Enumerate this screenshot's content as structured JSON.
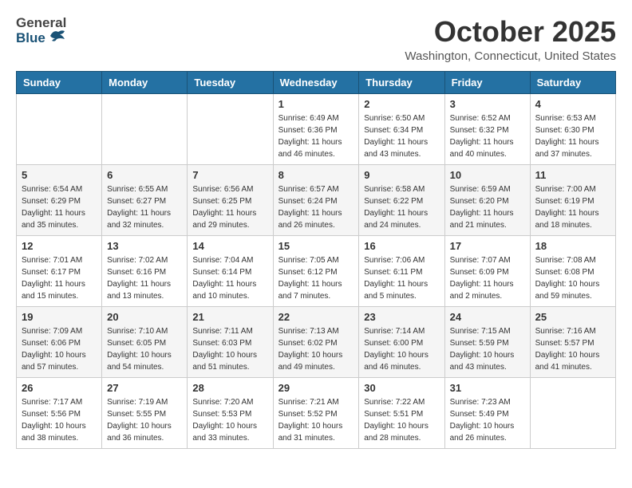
{
  "header": {
    "logo_general": "General",
    "logo_blue": "Blue",
    "month_title": "October 2025",
    "location": "Washington, Connecticut, United States"
  },
  "days_of_week": [
    "Sunday",
    "Monday",
    "Tuesday",
    "Wednesday",
    "Thursday",
    "Friday",
    "Saturday"
  ],
  "weeks": [
    [
      {
        "day": "",
        "info": ""
      },
      {
        "day": "",
        "info": ""
      },
      {
        "day": "",
        "info": ""
      },
      {
        "day": "1",
        "info": "Sunrise: 6:49 AM\nSunset: 6:36 PM\nDaylight: 11 hours and 46 minutes."
      },
      {
        "day": "2",
        "info": "Sunrise: 6:50 AM\nSunset: 6:34 PM\nDaylight: 11 hours and 43 minutes."
      },
      {
        "day": "3",
        "info": "Sunrise: 6:52 AM\nSunset: 6:32 PM\nDaylight: 11 hours and 40 minutes."
      },
      {
        "day": "4",
        "info": "Sunrise: 6:53 AM\nSunset: 6:30 PM\nDaylight: 11 hours and 37 minutes."
      }
    ],
    [
      {
        "day": "5",
        "info": "Sunrise: 6:54 AM\nSunset: 6:29 PM\nDaylight: 11 hours and 35 minutes."
      },
      {
        "day": "6",
        "info": "Sunrise: 6:55 AM\nSunset: 6:27 PM\nDaylight: 11 hours and 32 minutes."
      },
      {
        "day": "7",
        "info": "Sunrise: 6:56 AM\nSunset: 6:25 PM\nDaylight: 11 hours and 29 minutes."
      },
      {
        "day": "8",
        "info": "Sunrise: 6:57 AM\nSunset: 6:24 PM\nDaylight: 11 hours and 26 minutes."
      },
      {
        "day": "9",
        "info": "Sunrise: 6:58 AM\nSunset: 6:22 PM\nDaylight: 11 hours and 24 minutes."
      },
      {
        "day": "10",
        "info": "Sunrise: 6:59 AM\nSunset: 6:20 PM\nDaylight: 11 hours and 21 minutes."
      },
      {
        "day": "11",
        "info": "Sunrise: 7:00 AM\nSunset: 6:19 PM\nDaylight: 11 hours and 18 minutes."
      }
    ],
    [
      {
        "day": "12",
        "info": "Sunrise: 7:01 AM\nSunset: 6:17 PM\nDaylight: 11 hours and 15 minutes."
      },
      {
        "day": "13",
        "info": "Sunrise: 7:02 AM\nSunset: 6:16 PM\nDaylight: 11 hours and 13 minutes."
      },
      {
        "day": "14",
        "info": "Sunrise: 7:04 AM\nSunset: 6:14 PM\nDaylight: 11 hours and 10 minutes."
      },
      {
        "day": "15",
        "info": "Sunrise: 7:05 AM\nSunset: 6:12 PM\nDaylight: 11 hours and 7 minutes."
      },
      {
        "day": "16",
        "info": "Sunrise: 7:06 AM\nSunset: 6:11 PM\nDaylight: 11 hours and 5 minutes."
      },
      {
        "day": "17",
        "info": "Sunrise: 7:07 AM\nSunset: 6:09 PM\nDaylight: 11 hours and 2 minutes."
      },
      {
        "day": "18",
        "info": "Sunrise: 7:08 AM\nSunset: 6:08 PM\nDaylight: 10 hours and 59 minutes."
      }
    ],
    [
      {
        "day": "19",
        "info": "Sunrise: 7:09 AM\nSunset: 6:06 PM\nDaylight: 10 hours and 57 minutes."
      },
      {
        "day": "20",
        "info": "Sunrise: 7:10 AM\nSunset: 6:05 PM\nDaylight: 10 hours and 54 minutes."
      },
      {
        "day": "21",
        "info": "Sunrise: 7:11 AM\nSunset: 6:03 PM\nDaylight: 10 hours and 51 minutes."
      },
      {
        "day": "22",
        "info": "Sunrise: 7:13 AM\nSunset: 6:02 PM\nDaylight: 10 hours and 49 minutes."
      },
      {
        "day": "23",
        "info": "Sunrise: 7:14 AM\nSunset: 6:00 PM\nDaylight: 10 hours and 46 minutes."
      },
      {
        "day": "24",
        "info": "Sunrise: 7:15 AM\nSunset: 5:59 PM\nDaylight: 10 hours and 43 minutes."
      },
      {
        "day": "25",
        "info": "Sunrise: 7:16 AM\nSunset: 5:57 PM\nDaylight: 10 hours and 41 minutes."
      }
    ],
    [
      {
        "day": "26",
        "info": "Sunrise: 7:17 AM\nSunset: 5:56 PM\nDaylight: 10 hours and 38 minutes."
      },
      {
        "day": "27",
        "info": "Sunrise: 7:19 AM\nSunset: 5:55 PM\nDaylight: 10 hours and 36 minutes."
      },
      {
        "day": "28",
        "info": "Sunrise: 7:20 AM\nSunset: 5:53 PM\nDaylight: 10 hours and 33 minutes."
      },
      {
        "day": "29",
        "info": "Sunrise: 7:21 AM\nSunset: 5:52 PM\nDaylight: 10 hours and 31 minutes."
      },
      {
        "day": "30",
        "info": "Sunrise: 7:22 AM\nSunset: 5:51 PM\nDaylight: 10 hours and 28 minutes."
      },
      {
        "day": "31",
        "info": "Sunrise: 7:23 AM\nSunset: 5:49 PM\nDaylight: 10 hours and 26 minutes."
      },
      {
        "day": "",
        "info": ""
      }
    ]
  ]
}
